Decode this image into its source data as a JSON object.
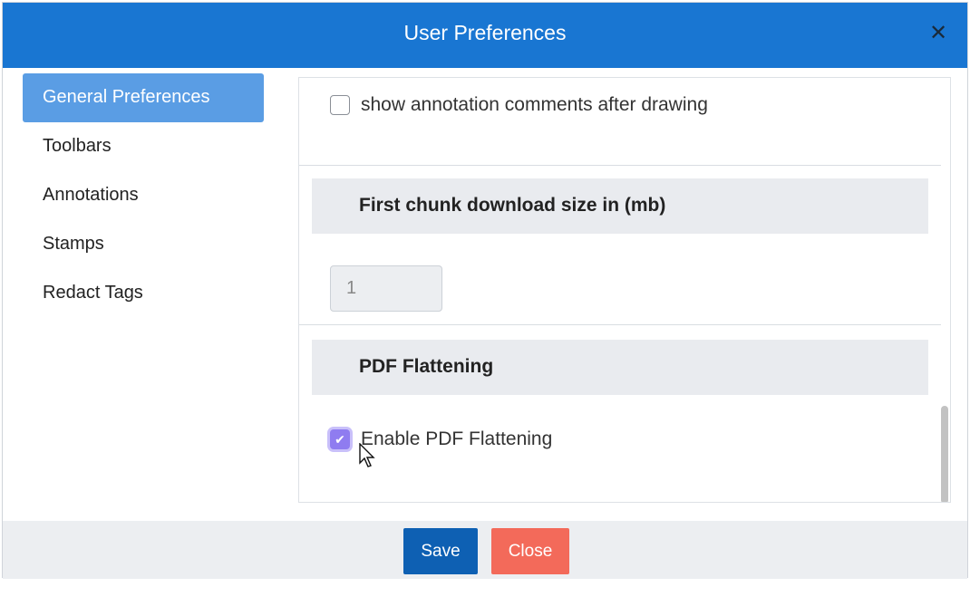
{
  "dialog": {
    "title": "User Preferences",
    "close_icon": "close-icon"
  },
  "sidebar": {
    "items": [
      {
        "label": "General Preferences",
        "active": true
      },
      {
        "label": "Toolbars",
        "active": false
      },
      {
        "label": "Annotations",
        "active": false
      },
      {
        "label": "Stamps",
        "active": false
      },
      {
        "label": "Redact Tags",
        "active": false
      }
    ]
  },
  "content": {
    "annotation_comments": {
      "label": "show annotation comments after drawing",
      "checked": false
    },
    "chunk_size": {
      "heading": "First chunk download size in (mb)",
      "value": "1"
    },
    "flattening": {
      "heading": "PDF Flattening",
      "checkbox_label": "Enable PDF Flattening",
      "checked": true
    }
  },
  "footer": {
    "save_label": "Save",
    "close_label": "Close"
  },
  "colors": {
    "titlebar": "#1976d2",
    "active_nav": "#5a9de4",
    "save": "#0e60b3",
    "close": "#f36a5a",
    "checkbox_checked": "#8f7cf0"
  }
}
